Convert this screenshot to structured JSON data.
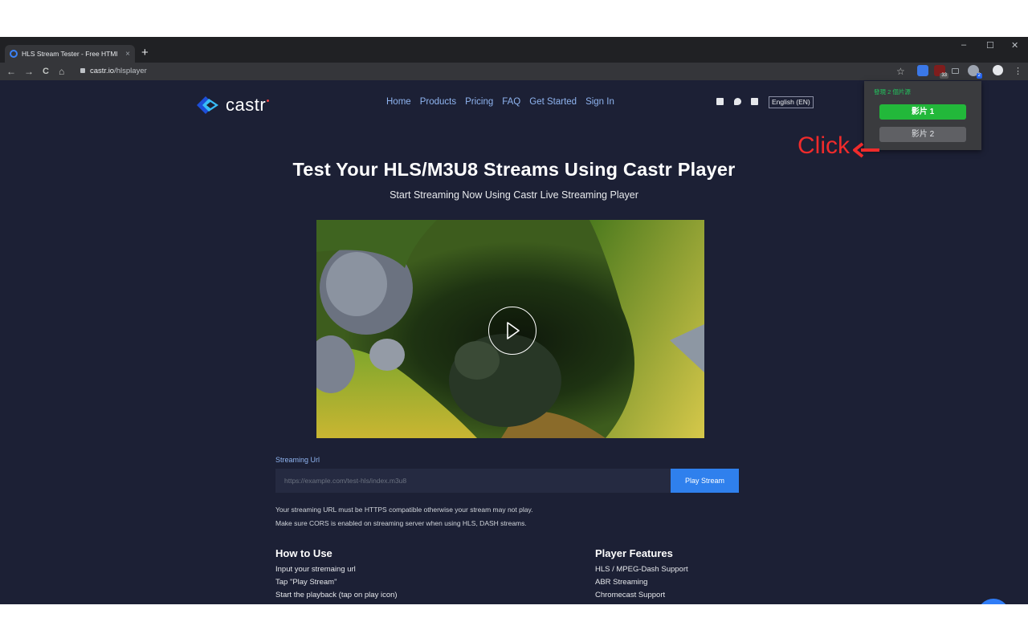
{
  "browser": {
    "tab_title": "HLS Stream Tester - Free HTMl",
    "tab_close": "×",
    "new_tab": "+",
    "win_min": "–",
    "win_max": "☐",
    "win_close": "✕",
    "url_host": "castr.io",
    "url_path": "/hlsplayer",
    "back": "←",
    "forward": "→",
    "reload": "C",
    "home": "⌂",
    "star": "☆",
    "menu": "⋮",
    "ext_badge_1": "33",
    "ext_badge_2": "2",
    "icons": [
      "tab-favicon-icon",
      "back-icon",
      "forward-icon",
      "reload-icon",
      "home-icon",
      "lock-icon",
      "star-icon",
      "translate-icon",
      "ublock-icon",
      "cast-icon",
      "video-extension-icon",
      "avatar-icon",
      "kebab-menu-icon"
    ]
  },
  "site": {
    "logo_text": "castr",
    "nav": [
      "Home",
      "Products",
      "Pricing",
      "FAQ",
      "Get Started",
      "Sign In"
    ],
    "language": "English (EN)",
    "hero_title": "Test Your HLS/M3U8 Streams Using Castr Player",
    "hero_subtitle": "Start Streaming Now Using Castr Live Streaming Player",
    "url_label": "Streaming Url",
    "url_placeholder": "https://example.com/test-hls/index.m3u8",
    "play_stream": "Play Stream",
    "note_1": "Your streaming URL must be HTTPS compatible otherwise your stream may not play.",
    "note_2": "Make sure CORS is enabled on streaming server when using HLS, DASH streams.",
    "how_to_use": {
      "title": "How to Use",
      "items": [
        "Input your stremaing url",
        "Tap \"Play Stream\"",
        "Start the playback (tap on play icon)"
      ]
    },
    "player_features": {
      "title": "Player Features",
      "items": [
        "HLS / MPEG-Dash Support",
        "ABR Streaming",
        "Chromecast Support"
      ]
    },
    "icons": [
      "castr-logo-icon",
      "facebook-icon",
      "twitter-icon",
      "linkedin-icon",
      "play-icon",
      "chat-icon"
    ]
  },
  "popup": {
    "header": "發現 2 個片源",
    "video_1": "影片 1",
    "video_2": "影片 2"
  },
  "annotation": {
    "text": "Click",
    "color": "#ef2b2b"
  },
  "colors": {
    "page_bg": "#1c2035",
    "accent_blue": "#2f80ed",
    "nav_link": "#8fb4f0",
    "popup_green": "#22b83a"
  }
}
